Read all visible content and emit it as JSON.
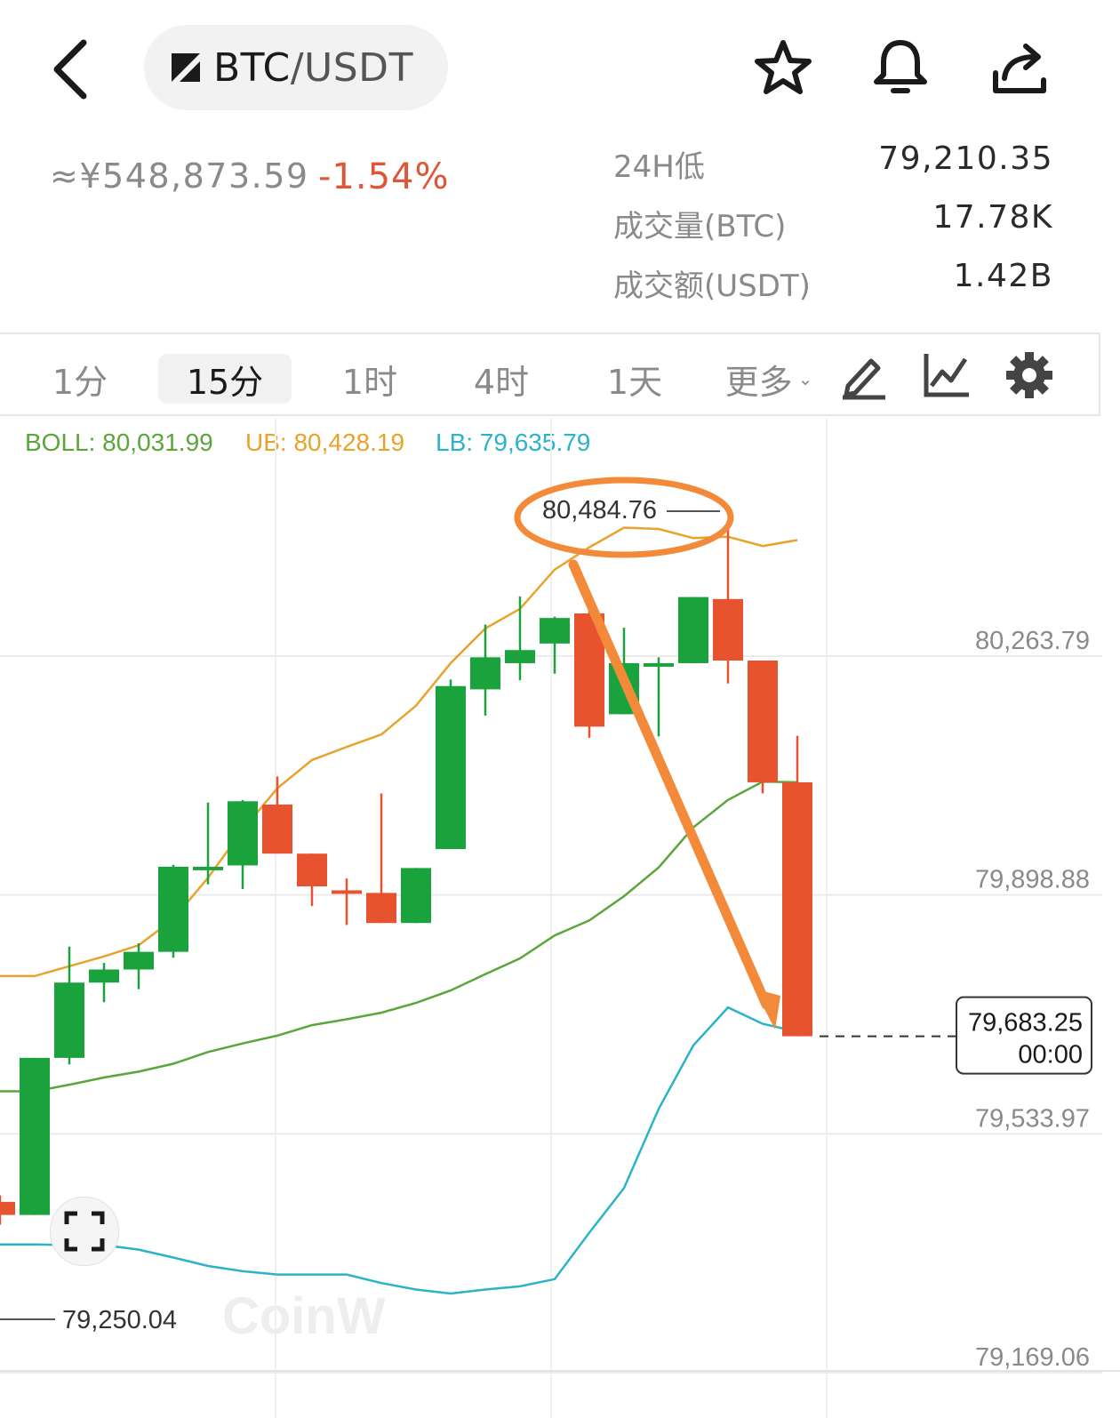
{
  "header": {
    "pair_base": "BTC",
    "pair_sep": "/",
    "pair_quote": "USDT",
    "icons": [
      "back-icon",
      "exchange-logo-icon",
      "star-icon",
      "bell-icon",
      "share-icon"
    ]
  },
  "price": {
    "cny_value": "≈¥548,873.59",
    "change_pct": "-1.54%",
    "change_color": "#e05536"
  },
  "stats": [
    {
      "label": "24H低",
      "value": "79,210.35"
    },
    {
      "label": "成交量(BTC)",
      "value": "17.78K"
    },
    {
      "label": "成交额(USDT)",
      "value": "1.42B"
    }
  ],
  "intervals": {
    "tabs": [
      "1分",
      "15分",
      "1时",
      "4时",
      "1天",
      "更多"
    ],
    "active": "15分",
    "tools": [
      "draw-icon",
      "indicator-icon",
      "settings-icon"
    ]
  },
  "legend": {
    "boll": "BOLL: 80,031.99",
    "ub": "UB: 80,428.19",
    "lb": "LB: 79,635.79",
    "colors": {
      "boll": "#5aa63c",
      "ub": "#e6a42a",
      "lb": "#2bb3c6"
    }
  },
  "chart_data": {
    "type": "candlestick",
    "y_ticks": [
      "80,263.79",
      "79,898.88",
      "79,533.97",
      "79,169.06"
    ],
    "y_tick_values": [
      80263.79,
      79898.88,
      79533.97,
      79169.06
    ],
    "high_label": "80,484.76",
    "low_label": "79,250.04",
    "last_price": "79,683.25",
    "last_time": "00:00",
    "colors": {
      "up": "#1aa33c",
      "down": "#e8532f",
      "annotation": "#f28a3a"
    },
    "candles": [
      {
        "o": 79430,
        "h": 79440,
        "l": 79395,
        "c": 79410
      },
      {
        "o": 79410,
        "h": 79580,
        "l": 79410,
        "c": 79650
      },
      {
        "o": 79650,
        "h": 79820,
        "l": 79640,
        "c": 79765
      },
      {
        "o": 79765,
        "h": 79795,
        "l": 79735,
        "c": 79785
      },
      {
        "o": 79785,
        "h": 79825,
        "l": 79755,
        "c": 79812
      },
      {
        "o": 79812,
        "h": 79945,
        "l": 79803,
        "c": 79942
      },
      {
        "o": 79940,
        "h": 80040,
        "l": 79915,
        "c": 79942
      },
      {
        "o": 79944,
        "h": 80044,
        "l": 79908,
        "c": 80042
      },
      {
        "o": 80037,
        "h": 80080,
        "l": 79965,
        "c": 79962
      },
      {
        "o": 79962,
        "h": 79932,
        "l": 79882,
        "c": 79912
      },
      {
        "o": 79906,
        "h": 79924,
        "l": 79853,
        "c": 79902
      },
      {
        "o": 79902,
        "h": 80054,
        "l": 79865,
        "c": 79856
      },
      {
        "o": 79856,
        "h": 79940,
        "l": 79856,
        "c": 79940
      },
      {
        "o": 79969,
        "h": 80228,
        "l": 79969,
        "c": 80218
      },
      {
        "o": 80213,
        "h": 80312,
        "l": 80173,
        "c": 80262
      },
      {
        "o": 80253,
        "h": 80355,
        "l": 80227,
        "c": 80273
      },
      {
        "o": 80283,
        "h": 80324,
        "l": 80237,
        "c": 80322
      },
      {
        "o": 80329,
        "h": 80345,
        "l": 80139,
        "c": 80156
      },
      {
        "o": 80175,
        "h": 80307,
        "l": 80175,
        "c": 80253
      },
      {
        "o": 80253,
        "h": 80262,
        "l": 80141,
        "c": 80253
      },
      {
        "o": 80253,
        "h": 80354,
        "l": 80253,
        "c": 80354
      },
      {
        "o": 80351,
        "h": 80469,
        "l": 80222,
        "c": 80257
      },
      {
        "o": 80257,
        "h": 80257,
        "l": 80054,
        "c": 80071
      },
      {
        "o": 80071,
        "h": 80142,
        "l": 79697,
        "c": 79683
      }
    ],
    "ub": [
      79775,
      79775,
      79790,
      79805,
      79822,
      79862,
      79925,
      79998,
      80062,
      80105,
      80125,
      80144,
      80188,
      80253,
      80306,
      80336,
      80396,
      80430,
      80460,
      80458,
      80444,
      80446,
      80432,
      80441
    ],
    "boll": [
      79599,
      79599,
      79609,
      79620,
      79629,
      79641,
      79659,
      79672,
      79684,
      79700,
      79709,
      79719,
      79734,
      79753,
      79778,
      79802,
      79837,
      79860,
      79897,
      79941,
      80002,
      80044,
      80072,
      80071
    ],
    "lb": [
      79365,
      79365,
      79364,
      79364,
      79357,
      79345,
      79332,
      79324,
      79319,
      79319,
      79319,
      79306,
      79296,
      79290,
      79296,
      79301,
      79312,
      79383,
      79451,
      79572,
      79669,
      79727,
      79702,
      79690
    ]
  },
  "watermark": "CoinW"
}
